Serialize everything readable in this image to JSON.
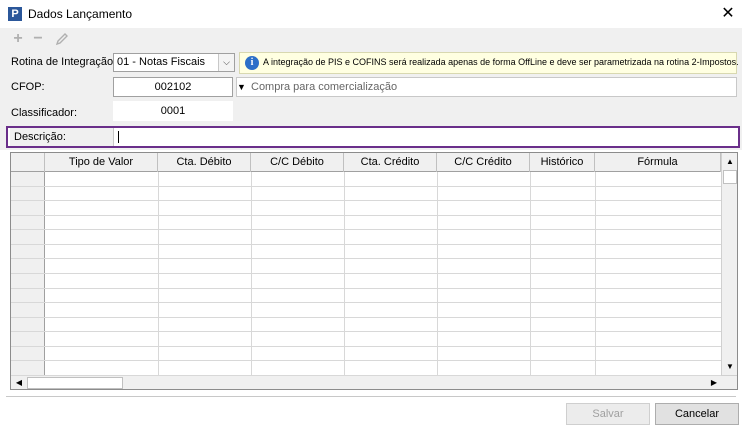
{
  "window": {
    "logo_letter": "P",
    "title": "Dados Lançamento",
    "close_glyph": "✕"
  },
  "toolbar": {
    "add_icon": "plus-icon",
    "remove_icon": "minus-icon",
    "edit_icon": "pencil-icon"
  },
  "form": {
    "rotina_label": "Rotina de Integração:",
    "rotina_value": "01 - Notas Fiscais",
    "info_text": "A integração de PIS e COFINS será realizada apenas de forma OffLine e deve ser parametrizada na rotina 2-Impostos.",
    "cfop_label": "CFOP:",
    "cfop_value": "002102",
    "cfop_description": "Compra para comercialização",
    "classificador_label": "Classificador:",
    "classificador_value": "0001",
    "descricao_label": "Descrição:",
    "descricao_value": ""
  },
  "grid": {
    "columns": [
      "Tipo de Valor",
      "Cta. Débito",
      "C/C Débito",
      "Cta. Crédito",
      "C/C Crédito",
      "Histórico",
      "Fórmula"
    ],
    "row_count": 14
  },
  "buttons": {
    "save_label": "Salvar",
    "cancel_label": "Cancelar"
  },
  "colors": {
    "focus_border": "#6a2f8a",
    "info_background": "#ffffe1",
    "info_icon": "#2c6fc8"
  }
}
